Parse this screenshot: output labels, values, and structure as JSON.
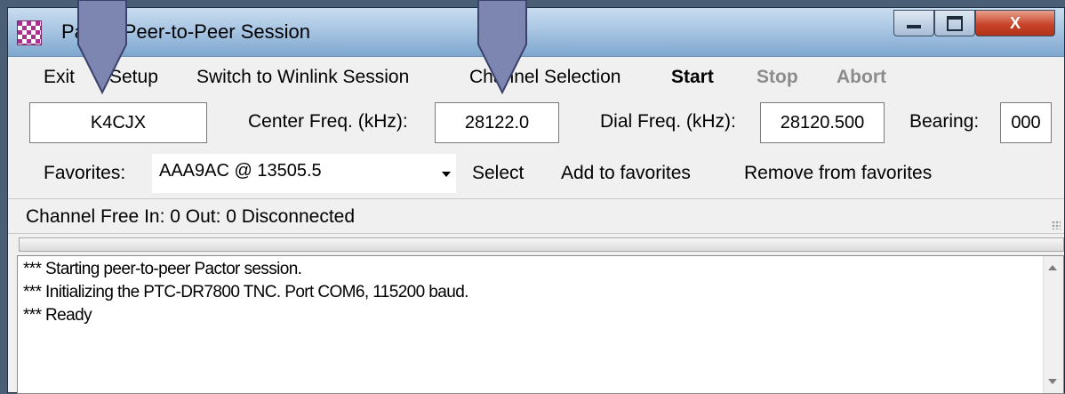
{
  "window": {
    "title": "Pactor Peer-to-Peer Session",
    "controls": {
      "minimize": "minimize-icon",
      "maximize": "maximize-icon",
      "close": "close-icon",
      "close_glyph": "X"
    }
  },
  "menu": {
    "exit": "Exit",
    "setup": "Setup",
    "switch": "Switch to Winlink Session",
    "channel_selection": "Channel Selection",
    "start": "Start",
    "stop": "Stop",
    "abort": "Abort"
  },
  "fields": {
    "callsign": "K4CJX",
    "center_freq_label": "Center Freq. (kHz):",
    "center_freq": "28122.0",
    "dial_freq_label": "Dial Freq. (kHz):",
    "dial_freq": "28120.500",
    "bearing_label": "Bearing:",
    "bearing": "000"
  },
  "favorites": {
    "label": "Favorites:",
    "selected": "AAA9AC  @  13505.5",
    "select": "Select",
    "add": "Add to favorites",
    "remove": "Remove from favorites"
  },
  "status": {
    "text": "Channel Free  In: 0  Out: 0  Disconnected"
  },
  "log": [
    "*** Starting peer-to-peer Pactor session.",
    "*** Initializing the PTC-DR7800 TNC.  Port COM6, 115200 baud.",
    "*** Ready"
  ],
  "colors": {
    "titlebar": "#a9c6e3",
    "close_button": "#c8452c",
    "callout_arrow": "#7d86b0",
    "disabled_text": "#8c8c8c"
  }
}
